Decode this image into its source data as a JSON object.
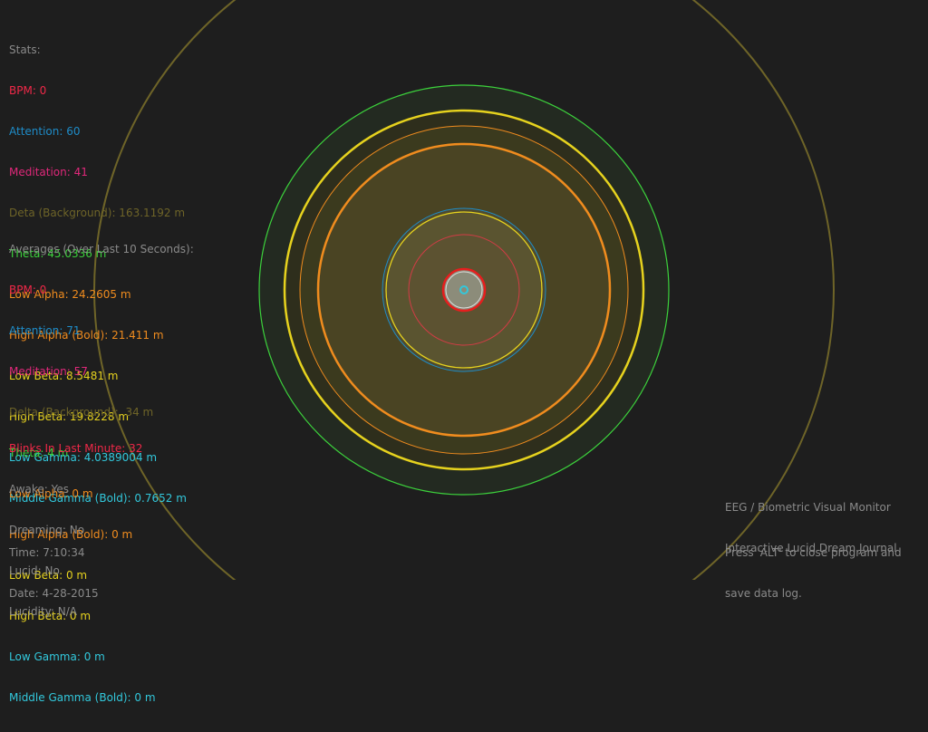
{
  "colors": {
    "background": "#1e1e1e",
    "label_gray": "#8a8a8a",
    "bpm_red": "#f02848",
    "attention_blue": "#1e8cc8",
    "meditation_magenta": "#e0287a",
    "delta_olive": "#6e6428",
    "theta_green": "#3cd23c",
    "alpha_orange": "#f08c1e",
    "beta_yellow": "#e6d21e",
    "gamma_cyan": "#32c8dc"
  },
  "stats": {
    "heading": "Stats:",
    "bpm": "BPM: 0",
    "attention": "Attention: 60",
    "meditation": "Meditation: 41",
    "delta": "Deta (Background): 163.1192 m",
    "theta": "Theta: 45.0336 m",
    "low_alpha": "Low Alpha: 24.2605 m",
    "high_alpha": "High Alpha (Bold): 21.411 m",
    "low_beta": "Low Beta: 8.5481 m",
    "high_beta": "High Beta: 19.8228 m",
    "low_gamma": "Low Gamma: 4.0389004 m",
    "mid_gamma": "Middle Gamma (Bold): 0.7652 m"
  },
  "averages": {
    "heading": "Averages (Over Last 10 Seconds):",
    "bpm": "BPM: 0",
    "attention": "Attention: 71",
    "meditation": "Meditation: 57",
    "delta": "Delta (Background):  34 m",
    "theta": "Theta: 4 m",
    "low_alpha": "Low Alpha: 0 m",
    "high_alpha": "High Alpha (Bold): 0 m",
    "low_beta": "Low Beta: 0 m",
    "high_beta": "High Beta: 0 m",
    "low_gamma": "Low Gamma: 0 m",
    "mid_gamma": "Middle Gamma (Bold): 0 m"
  },
  "status": {
    "blinks": "Blinks In Last Minute: 32",
    "awake": "Awake: Yes",
    "dreaming": "Dreaming: No",
    "lucid": "Lucid: No",
    "lucidity": "Lucidity: N/A"
  },
  "clock": {
    "time": "Time: 7:10:34",
    "date": "Date: 4-28-2015"
  },
  "about": {
    "line1": "EEG / Biometric Visual Monitor",
    "line2": "Interactive Lucid Dream Journal"
  },
  "help": {
    "line1": "Press 'ALT' to close program and",
    "line2": "save data log."
  }
}
